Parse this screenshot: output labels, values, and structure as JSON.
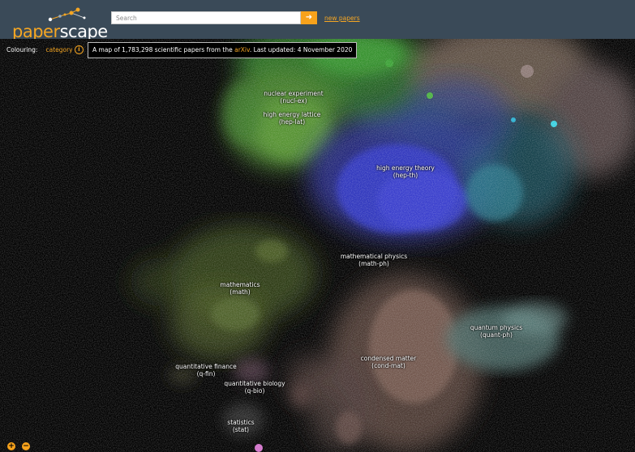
{
  "header": {
    "logo_part1": "paper",
    "logo_part2": "scape",
    "search_placeholder": "Search",
    "search_button_icon": "arrow-right-icon",
    "new_papers_label": "new papers"
  },
  "info": {
    "colouring_label": "Colouring:",
    "colouring_value": "category",
    "info_icon": "info-circle-icon",
    "summary_prefix": "A map of 1,783,298 scientific papers from the ",
    "summary_source": "arXiv",
    "summary_suffix": ". Last updated: 4 November 2020"
  },
  "categories": [
    {
      "name": "nuclear experiment",
      "code": "(nucl-ex)"
    },
    {
      "name": "high energy lattice",
      "code": "(hep-lat)"
    },
    {
      "name": "high energy theory",
      "code": "(hep-th)"
    },
    {
      "name": "mathematical physics",
      "code": "(math-ph)"
    },
    {
      "name": "mathematics",
      "code": "(math)"
    },
    {
      "name": "quantum physics",
      "code": "(quant-ph)"
    },
    {
      "name": "condensed matter",
      "code": "(cond-mat)"
    },
    {
      "name": "quantitative finance",
      "code": "(q-fin)"
    },
    {
      "name": "quantitative biology",
      "code": "(q-bio)"
    },
    {
      "name": "statistics",
      "code": "(stat)"
    }
  ],
  "colors": {
    "header_bg": "#3a4a58",
    "accent": "#f5a623",
    "hep_th": "#3a3ec8",
    "math": "#5f7a2c",
    "cond_mat": "#8a6a5e",
    "quant_ph": "#6f9a98",
    "nucl": "#4f9a2e"
  },
  "zoom": {
    "in_icon": "zoom-in-icon",
    "out_icon": "zoom-out-icon"
  }
}
